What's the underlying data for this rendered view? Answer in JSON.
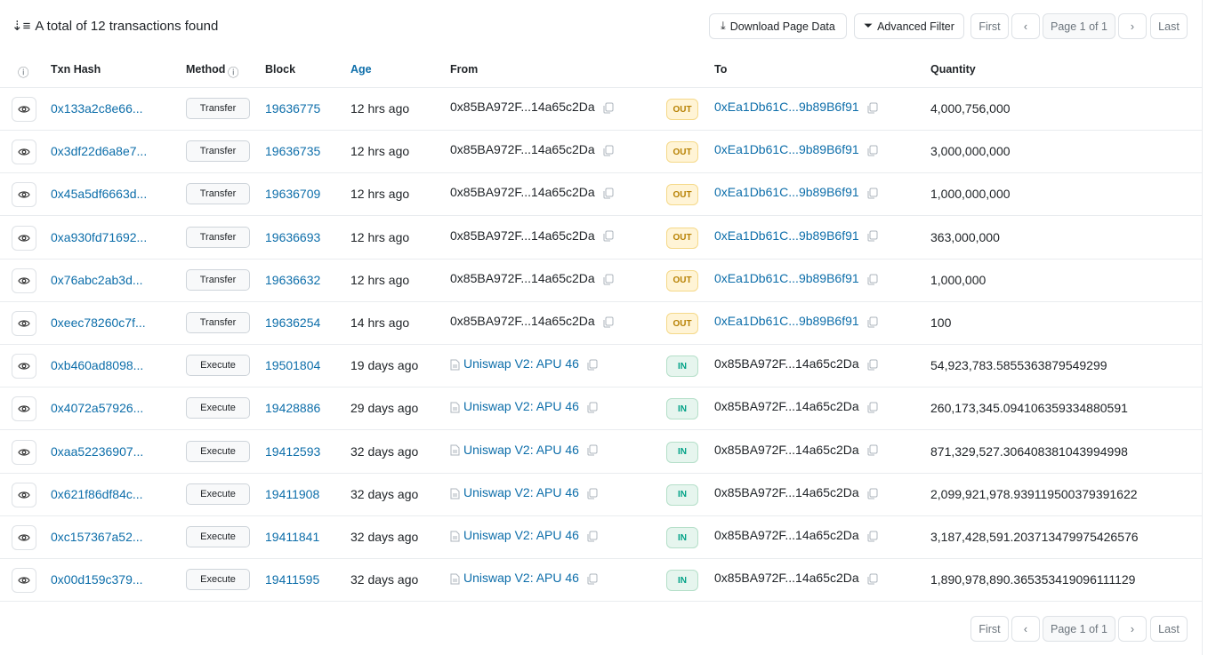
{
  "header": {
    "title": "A total of 12 transactions found",
    "download": "Download Page Data",
    "filter": "Advanced Filter"
  },
  "pagination": {
    "first": "First",
    "page": "Page 1 of 1",
    "last": "Last"
  },
  "columns": {
    "txn_hash": "Txn Hash",
    "method": "Method",
    "block": "Block",
    "age": "Age",
    "from": "From",
    "to": "To",
    "quantity": "Quantity"
  },
  "colors": {
    "link": "#0d6eaa",
    "out": "#b78103",
    "in": "#00a186"
  },
  "rows": [
    {
      "hash": "0x133a2c8e66...",
      "method": "Transfer",
      "block": "19636775",
      "age": "12 hrs ago",
      "from": "0x85BA972F...14a65c2Da",
      "from_contract": false,
      "dir": "OUT",
      "to": "0xEa1Db61C...9b89B6f91",
      "to_link": true,
      "qty": "4,000,756,000"
    },
    {
      "hash": "0x3df22d6a8e7...",
      "method": "Transfer",
      "block": "19636735",
      "age": "12 hrs ago",
      "from": "0x85BA972F...14a65c2Da",
      "from_contract": false,
      "dir": "OUT",
      "to": "0xEa1Db61C...9b89B6f91",
      "to_link": true,
      "qty": "3,000,000,000"
    },
    {
      "hash": "0x45a5df6663d...",
      "method": "Transfer",
      "block": "19636709",
      "age": "12 hrs ago",
      "from": "0x85BA972F...14a65c2Da",
      "from_contract": false,
      "dir": "OUT",
      "to": "0xEa1Db61C...9b89B6f91",
      "to_link": true,
      "qty": "1,000,000,000"
    },
    {
      "hash": "0xa930fd71692...",
      "method": "Transfer",
      "block": "19636693",
      "age": "12 hrs ago",
      "from": "0x85BA972F...14a65c2Da",
      "from_contract": false,
      "dir": "OUT",
      "to": "0xEa1Db61C...9b89B6f91",
      "to_link": true,
      "qty": "363,000,000"
    },
    {
      "hash": "0x76abc2ab3d...",
      "method": "Transfer",
      "block": "19636632",
      "age": "12 hrs ago",
      "from": "0x85BA972F...14a65c2Da",
      "from_contract": false,
      "dir": "OUT",
      "to": "0xEa1Db61C...9b89B6f91",
      "to_link": true,
      "qty": "1,000,000"
    },
    {
      "hash": "0xeec78260c7f...",
      "method": "Transfer",
      "block": "19636254",
      "age": "14 hrs ago",
      "from": "0x85BA972F...14a65c2Da",
      "from_contract": false,
      "dir": "OUT",
      "to": "0xEa1Db61C...9b89B6f91",
      "to_link": true,
      "qty": "100"
    },
    {
      "hash": "0xb460ad8098...",
      "method": "Execute",
      "block": "19501804",
      "age": "19 days ago",
      "from": "Uniswap V2: APU 46",
      "from_contract": true,
      "dir": "IN",
      "to": "0x85BA972F...14a65c2Da",
      "to_link": false,
      "qty": "54,923,783.5855363879549299"
    },
    {
      "hash": "0x4072a57926...",
      "method": "Execute",
      "block": "19428886",
      "age": "29 days ago",
      "from": "Uniswap V2: APU 46",
      "from_contract": true,
      "dir": "IN",
      "to": "0x85BA972F...14a65c2Da",
      "to_link": false,
      "qty": "260,173,345.094106359334880591"
    },
    {
      "hash": "0xaa52236907...",
      "method": "Execute",
      "block": "19412593",
      "age": "32 days ago",
      "from": "Uniswap V2: APU 46",
      "from_contract": true,
      "dir": "IN",
      "to": "0x85BA972F...14a65c2Da",
      "to_link": false,
      "qty": "871,329,527.306408381043994998"
    },
    {
      "hash": "0x621f86df84c...",
      "method": "Execute",
      "block": "19411908",
      "age": "32 days ago",
      "from": "Uniswap V2: APU 46",
      "from_contract": true,
      "dir": "IN",
      "to": "0x85BA972F...14a65c2Da",
      "to_link": false,
      "qty": "2,099,921,978.939119500379391622"
    },
    {
      "hash": "0xc157367a52...",
      "method": "Execute",
      "block": "19411841",
      "age": "32 days ago",
      "from": "Uniswap V2: APU 46",
      "from_contract": true,
      "dir": "IN",
      "to": "0x85BA972F...14a65c2Da",
      "to_link": false,
      "qty": "3,187,428,591.203713479975426576"
    },
    {
      "hash": "0x00d159c379...",
      "method": "Execute",
      "block": "19411595",
      "age": "32 days ago",
      "from": "Uniswap V2: APU 46",
      "from_contract": true,
      "dir": "IN",
      "to": "0x85BA972F...14a65c2Da",
      "to_link": false,
      "qty": "1,890,978,890.365353419096111129"
    }
  ]
}
